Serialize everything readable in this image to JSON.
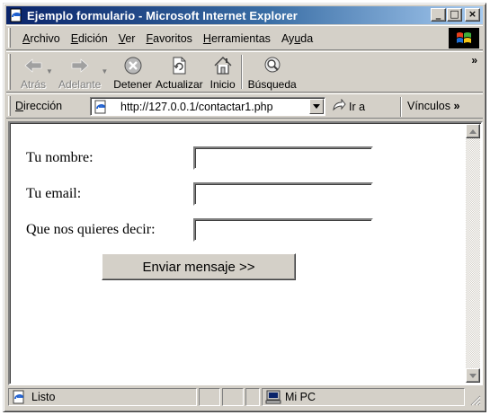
{
  "window": {
    "title": "Ejemplo formulario - Microsoft Internet Explorer",
    "buttons": {
      "minimize": "_",
      "maximize": "□",
      "close": "×"
    }
  },
  "menu": {
    "items": [
      {
        "underline": "A",
        "rest": "rchivo"
      },
      {
        "underline": "E",
        "rest": "dición"
      },
      {
        "underline": "V",
        "rest": "er"
      },
      {
        "underline": "F",
        "rest": "avoritos"
      },
      {
        "underline": "H",
        "rest": "erramientas"
      },
      {
        "pre": "Ay",
        "underline": "u",
        "rest": "da"
      }
    ]
  },
  "toolbar": {
    "back": "Atrás",
    "forward": "Adelante",
    "stop": "Detener",
    "refresh": "Actualizar",
    "home": "Inicio",
    "search": "Búsqueda",
    "more": "»"
  },
  "address": {
    "label_underline": "D",
    "label_rest": "irección",
    "url": "http://127.0.0.1/contactar1.php",
    "go": "Ir a",
    "links": "Vínculos",
    "links_more": "»"
  },
  "form": {
    "name_label": "Tu nombre:",
    "name_value": "",
    "email_label": "Tu email:",
    "email_value": "",
    "message_label": "Que nos quieres decir:",
    "message_value": "",
    "submit": "Enviar mensaje >>"
  },
  "status": {
    "text": "Listo",
    "zone": "Mi PC"
  },
  "colors": {
    "title_start": "#0a246a",
    "title_end": "#a6caf0",
    "chrome": "#d4d0c8"
  }
}
